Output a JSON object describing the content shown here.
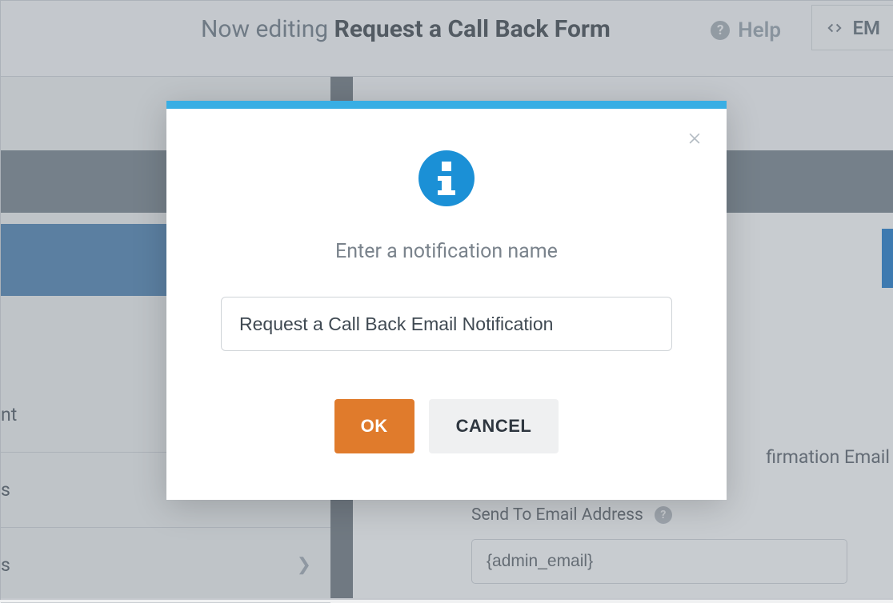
{
  "header": {
    "editing_prefix": "Now editing",
    "form_name": "Request a Call Back Form",
    "help_label": "Help",
    "embed_label": "EM"
  },
  "sidebar": {
    "items": [
      {
        "label_fragment": "nt"
      },
      {
        "label_fragment": "s"
      },
      {
        "label_fragment": "s"
      }
    ]
  },
  "main": {
    "confirmation_fragment": "firmation Email",
    "send_to_label": "Send To Email Address",
    "send_to_value": "{admin_email}"
  },
  "modal": {
    "prompt": "Enter a notification name",
    "input_value": "Request a Call Back Email Notification",
    "ok_label": "OK",
    "cancel_label": "CANCEL"
  }
}
